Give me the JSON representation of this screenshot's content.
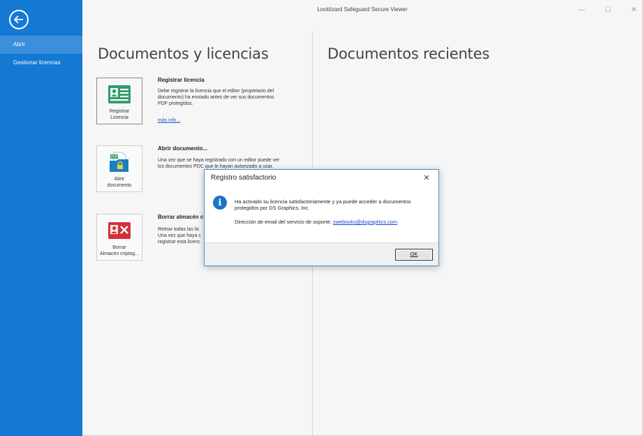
{
  "window": {
    "title": "Locklizard Safeguard Secure Viewer",
    "controls": {
      "minimize": "—",
      "maximize": "☐",
      "close": "✕"
    }
  },
  "sidebar": {
    "back_icon": "arrow-left-icon",
    "items": [
      {
        "label": "Abrir",
        "active": true
      },
      {
        "label": "Gestionar licencias",
        "active": false
      }
    ]
  },
  "left_section": {
    "title": "Documentos y licencias",
    "blocks": [
      {
        "tile_label": "Registrar\nLicencia",
        "icon": "license-card-icon",
        "title": "Registrar licencia",
        "description": "Debe registrar la licencia que el editor (propietario del\ndocumento) ha enviado antes de ver sus documentos\nPDF protegidos.",
        "link": "más info..."
      },
      {
        "tile_label": "Abrir\ndocumento",
        "icon": "pdf-folder-lock-icon",
        "title": "Abrir documento...",
        "description": "Una vez que se haya registrado con un editor puede ver\nlos documentos PDC que le hayan autorizado a usar."
      },
      {
        "tile_label": "Borrar\nAlmacén criptog...",
        "icon": "delete-store-icon",
        "title": "Borrar almacén c",
        "description": "Retirar todas las lic\nUna vez que haya c\nregistrar esta licenc"
      }
    ]
  },
  "right_section": {
    "title": "Documentos recientes"
  },
  "dialog": {
    "title": "Registro satisfactorio",
    "close": "✕",
    "message": "Ha activado su licencia satisfactoriamente y ya puede acceder a documentos protegidos por DS Graphics, Inc.",
    "support_label": "Dirección de email del servicio de soporte:",
    "support_email": "swebooks@dsgraphics.com",
    "ok_label": "OK"
  },
  "colors": {
    "sidebar": "#1479d3",
    "sidebar_active": "#3b8fdb",
    "accent_green": "#2e9b6a",
    "accent_red": "#d1323a",
    "link": "#1a55c9"
  }
}
